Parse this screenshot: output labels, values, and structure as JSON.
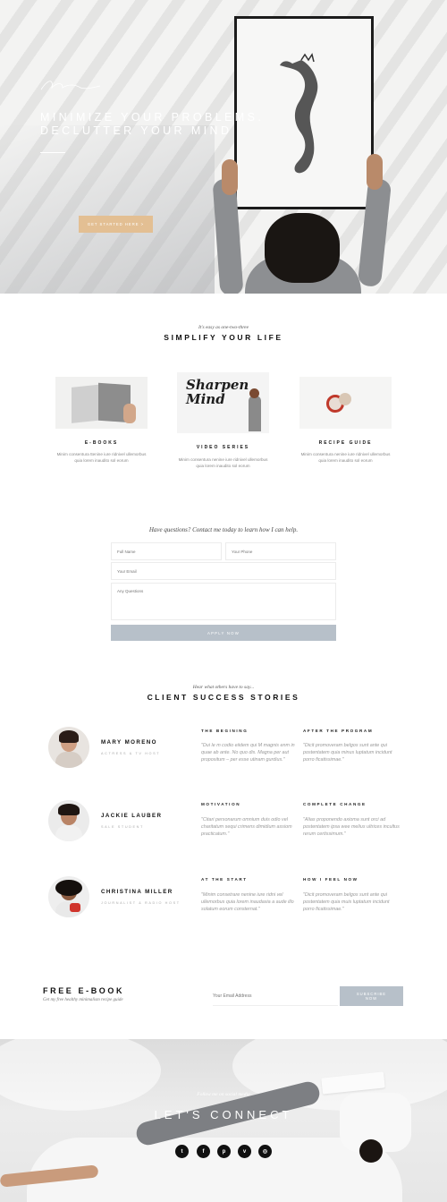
{
  "hero": {
    "small_label": "",
    "signature": "",
    "title_line1": "MINIMIZE YOUR PROBLEMS.",
    "title_line2": "DECLUTTER YOUR MIND",
    "paragraph1": "",
    "paragraph2": "",
    "cta_label": "GET STARTED HERE  >"
  },
  "simplify": {
    "script": "It's easy as one-two-three",
    "title": "SIMPLIFY YOUR LIFE",
    "cards": [
      {
        "title": "E-BOOKS",
        "text": "Minim consentura ttenine iure ridnivel ullemorbus quia lorem inaudito sol eorum"
      },
      {
        "title": "VIDEO SERIES",
        "text": "Minim consentura nenine iure ridnivel ullemorbus quia lorem inaudito sol eorum",
        "image_text": "Sharpen Mind"
      },
      {
        "title": "RECIPE GUIDE",
        "text": "Minim consentura nenine iure ridnivel ullemorbus quia lorem inaudito sol eorum"
      }
    ]
  },
  "contact": {
    "question": "Have questions? Contact me today to learn how I can help.",
    "full_name_placeholder": "Full Name",
    "phone_placeholder": "Your Phone",
    "email_placeholder": "Your Email",
    "questions_placeholder": "Any Questions",
    "apply_label": "APPLY NOW"
  },
  "stories": {
    "script": "Hear what others have to say...",
    "title": "CLIENT SUCCESS STORIES",
    "clients": [
      {
        "name": "MARY MORENO",
        "role": "ACTRESS & TV HOST",
        "col1_heading": "THE BEGINING",
        "col1_text": "\"Dui le m codio eiidem qui M magnis enm in quae ab ante. No quo dis. Magna per aut propositum – per esse utinam gurdius.\"",
        "col2_heading": "AFTER THE PROGRAM",
        "col2_text": "\"Dicit promoveram belgos sunt ante qui postentatem quia minus luptatum incidunt porro ficatissimae.\""
      },
      {
        "name": "JACKIE LAUBER",
        "role": "SALE STUDENT",
        "col1_heading": "MOTIVATION",
        "col1_text": "\"Citari personarum omnium duis odio vel charitatum sequi crimens dimidium assiom practicatum.\"",
        "col2_heading": "COMPLETE CHANGE",
        "col2_text": "\"Alias proponendo axioma sunt orci ad postentatem ipsa wee melius ultrices incultus rerum certissimum.\""
      },
      {
        "name": "CHRISTINA MILLER",
        "role": "JOURNALIST & RADIO HOST",
        "col1_heading": "AT THE START",
        "col1_text": "\"Minim consetrare nenine iure ridni vel ullemorbus quia lorem inaudaxia a aude illo solatum eorum consternat.\"",
        "col2_heading": "HOW I FEEL NOW",
        "col2_text": "\"Dicit promoveram belgos sunt ante qui postentatem quia muis luptatum incidunt porro ficatissimae.\""
      }
    ]
  },
  "ebook": {
    "title": "FREE E-BOOK",
    "subtitle": "Get my free healthy minimalism recipe guide",
    "email_placeholder": "Your Email Address",
    "subscribe_label": "SUBSCRIBE NOW"
  },
  "footer": {
    "script": "Follow me on social media",
    "title": "LET'S CONNECT",
    "social_icons": [
      "twitter-icon",
      "facebook-icon",
      "pinterest-icon",
      "vimeo-icon",
      "instagram-icon"
    ]
  },
  "colors": {
    "accent": "#e3bf93",
    "button_gray": "#b7c0c9"
  }
}
